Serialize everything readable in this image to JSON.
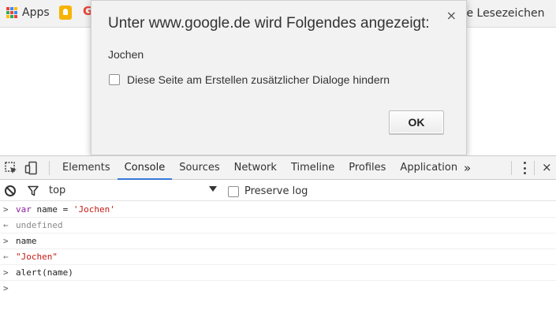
{
  "bookmarks": {
    "apps_label": "Apps",
    "google_letter": "G",
    "other_bookmarks_partial": "re Lesezeichen"
  },
  "dialog": {
    "title": "Unter www.google.de wird Folgendes angezeigt:",
    "message": "Jochen",
    "checkbox_label": "Diese Seite am Erstellen zusätzlicher Dialoge hindern",
    "ok_label": "OK",
    "close_glyph": "×"
  },
  "devtools": {
    "tabs": [
      {
        "label": "Elements"
      },
      {
        "label": "Console"
      },
      {
        "label": "Sources"
      },
      {
        "label": "Network"
      },
      {
        "label": "Timeline"
      },
      {
        "label": "Profiles"
      },
      {
        "label": "Application"
      }
    ],
    "active_tab": "Console",
    "more_glyph": "»",
    "close_glyph": "×",
    "console_bar": {
      "context": "top",
      "preserve_log": "Preserve log"
    },
    "console_lines": {
      "l1_keyword": "var",
      "l1_rest": " name = ",
      "l1_string": "'Jochen'",
      "l2_result": "undefined",
      "l3_input": "name",
      "l4_result": "\"Jochen\"",
      "l5_input": "alert(name)",
      "input_prefix": ">",
      "result_prefix": "←",
      "prompt_prefix": ">"
    }
  },
  "colors": {
    "accent": "#3879d9",
    "keyword": "#8a1f9e",
    "string": "#c41a16",
    "dialog_bg": "#f2f2f2",
    "prompt": "#367cf1"
  }
}
